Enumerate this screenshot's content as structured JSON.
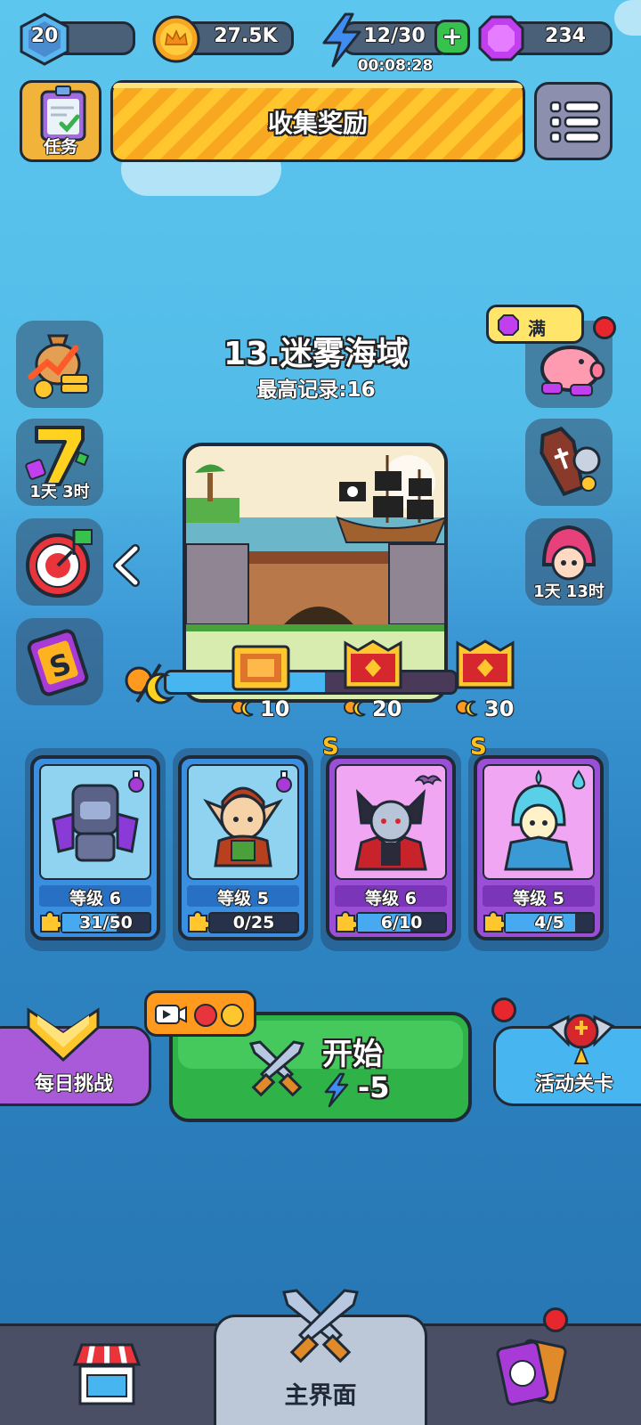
{
  "top_bar": {
    "player_level": "20",
    "xp_progress": 0.15,
    "gold": "27.5K",
    "energy": "12/30",
    "energy_timer": "00:08:28",
    "gems": "234"
  },
  "header": {
    "tasks_label": "任务",
    "collect_reward_label": "收集奖励"
  },
  "left_icons": {
    "seven_day_timer": "1天 3时"
  },
  "right_icons": {
    "piggy_bank_status": "满",
    "event_timer": "1天 13时"
  },
  "level": {
    "title": "13.迷雾海域",
    "best_record": "最高记录:16"
  },
  "chest_milestones": [
    "10",
    "20",
    "30"
  ],
  "chest_progress": 0.55,
  "heroes": [
    {
      "level": "等级 6",
      "progress": "31/50",
      "progress_value": 0.62,
      "rarity": "",
      "color": "blue"
    },
    {
      "level": "等级 5",
      "progress": "0/25",
      "progress_value": 0.0,
      "rarity": "",
      "color": "blue"
    },
    {
      "level": "等级 6",
      "progress": "6/10",
      "progress_value": 0.6,
      "rarity": "S",
      "color": "purple"
    },
    {
      "level": "等级 5",
      "progress": "4/5",
      "progress_value": 0.8,
      "rarity": "S",
      "color": "purple"
    }
  ],
  "actions": {
    "daily_challenge": "每日挑战",
    "start_label": "开始",
    "start_cost": "-5",
    "event_level": "活动关卡"
  },
  "nav": {
    "main_label": "主界面"
  },
  "colors": {
    "accent_yellow": "#ffc62e",
    "start_green": "#2fb348",
    "blue_card": "#3a8fe0",
    "purple_card": "#9a4fd6"
  }
}
